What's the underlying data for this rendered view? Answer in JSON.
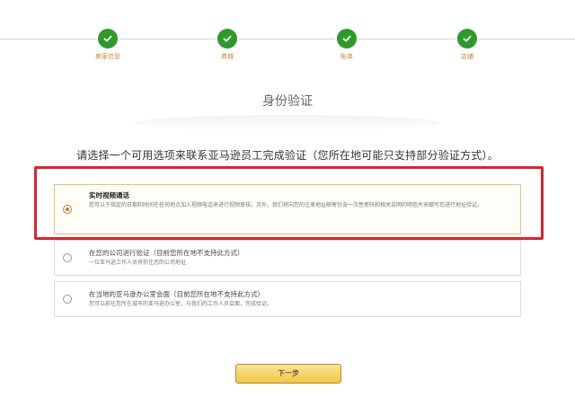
{
  "progress": {
    "steps": [
      {
        "label": "卖家信息"
      },
      {
        "label": "商城"
      },
      {
        "label": "账单"
      },
      {
        "label": "店铺"
      }
    ],
    "active_color": "#2e9a2a"
  },
  "page": {
    "title": "身份验证",
    "instruction": "请选择一个可用选项来联系亚马逊员工完成验证（您所在地可能只支持部分验证方式）。"
  },
  "options": [
    {
      "title": "实时视频通话",
      "description": "您可以于指定的日期和时间在任何地点加入视频电话来进行视频审核。另外，我们将向您的注册地址邮寄包含一次性密码和相关说明的明信片来缩写您进行地址验证。",
      "selected": true
    },
    {
      "title": "在您的公司进行验证（目前您所在地不支持此方式）",
      "description": "一位亚马逊工作人员将前往您的公司地址",
      "selected": false
    },
    {
      "title": "在当地的亚马逊办公室会面（目前您所在地不支持此方式）",
      "description": "您可以前往您所在城市的亚马逊办公室，与我们的工作人员会面，完成验证。",
      "selected": false
    }
  ],
  "actions": {
    "next_label": "下一步"
  },
  "colors": {
    "highlight": "#d8252d",
    "button": "#f1c642"
  }
}
